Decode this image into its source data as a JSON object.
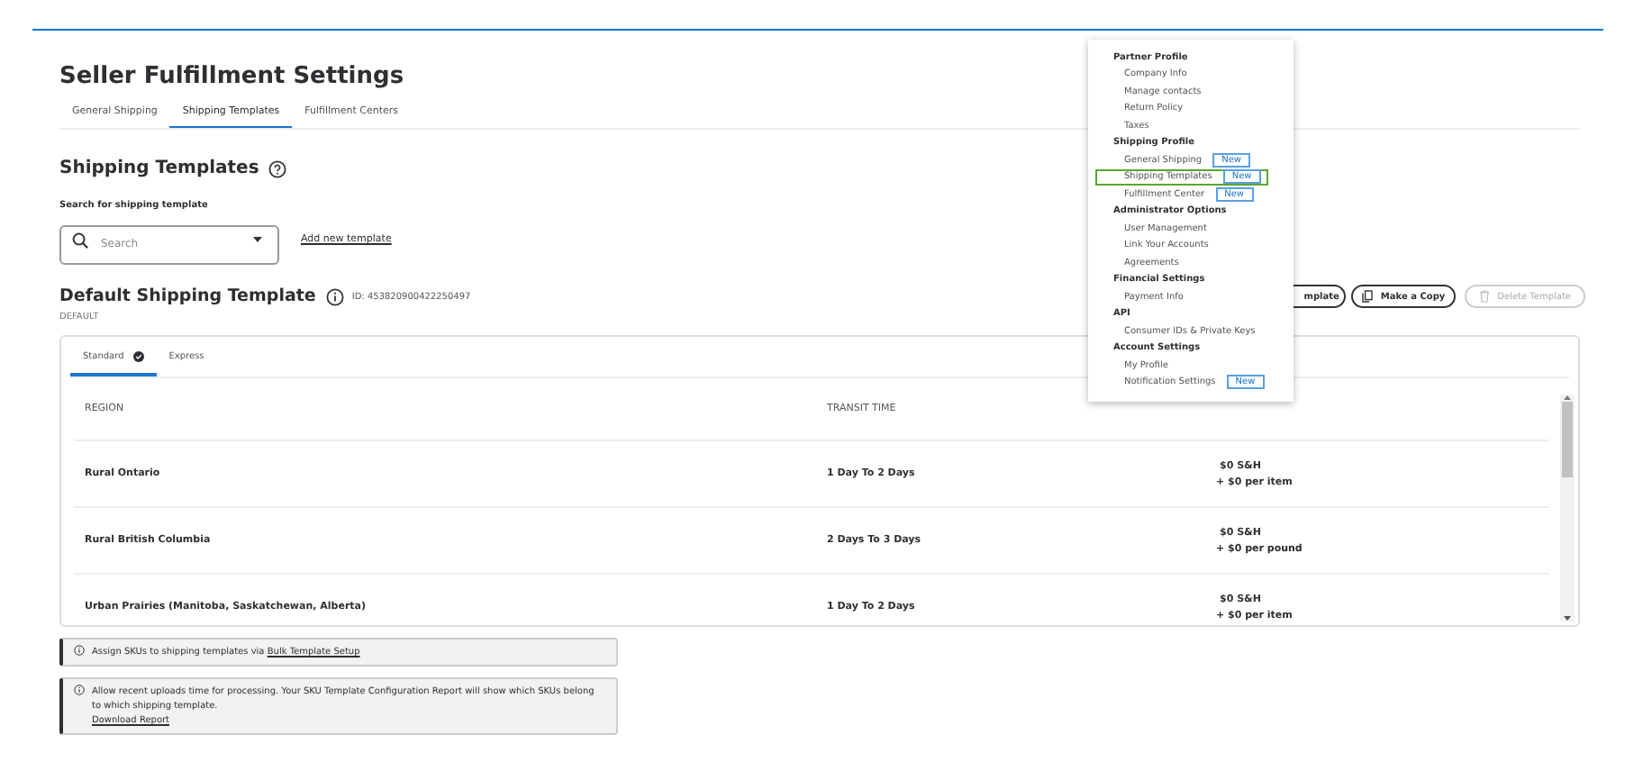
{
  "page": {
    "title": "Seller Fulfillment Settings"
  },
  "tabs": [
    {
      "label": "General Shipping",
      "selected": false
    },
    {
      "label": "Shipping Templates",
      "selected": true
    },
    {
      "label": "Fulfillment Centers",
      "selected": false
    }
  ],
  "section": {
    "title": "Shipping Templates"
  },
  "search": {
    "label": "Search for shipping template",
    "placeholder": "Search"
  },
  "add_link": "Add new template",
  "template": {
    "title": "Default Shipping Template",
    "id": "ID: 453820900422250497",
    "tag": "DEFAULT"
  },
  "actions": [
    {
      "kind": "plain",
      "label": "mplate",
      "disabled": false
    },
    {
      "kind": "copy",
      "label": "Make a Copy",
      "disabled": false
    },
    {
      "kind": "delete",
      "label": "Delete Template",
      "disabled": true
    }
  ],
  "method_tabs": [
    {
      "label": "Standard",
      "selected": true,
      "checked": true
    },
    {
      "label": "Express",
      "selected": false,
      "checked": false
    }
  ],
  "table": {
    "columns": [
      "REGION",
      "TRANSIT TIME"
    ],
    "rows": [
      {
        "region": "Rural Ontario",
        "transit": "1 Day  To  2 Days",
        "rate": "$0 S&H",
        "rate_extra": "+ $0 per item"
      },
      {
        "region": "Rural British Columbia",
        "transit": "2 Days  To  3 Days",
        "rate": "$0 S&H",
        "rate_extra": "+ $0 per pound"
      },
      {
        "region": "Urban Prairies (Manitoba, Saskatchewan, Alberta)",
        "transit": "1 Day  To  2 Days",
        "rate": "$0 S&H",
        "rate_extra": "+ $0 per item"
      }
    ]
  },
  "notices": [
    {
      "text": "Assign SKUs to shipping templates via ",
      "link": "Bulk Template Setup",
      "link_inline": true
    },
    {
      "text": "Allow recent uploads time for processing. Your SKU Template Configuration Report will show which SKUs belong to which shipping template.",
      "link": "Download Report",
      "link_inline": false
    }
  ],
  "menu": {
    "groups": [
      {
        "title": "Partner Profile",
        "items": [
          {
            "label": "Company Info",
            "highlighted": false
          },
          {
            "label": "Manage contacts",
            "highlighted": false
          },
          {
            "label": "Return Policy",
            "highlighted": false
          },
          {
            "label": "Taxes",
            "highlighted": false
          }
        ]
      },
      {
        "title": "Shipping Profile",
        "items": [
          {
            "label": "General Shipping",
            "badge": "New",
            "highlighted": false
          },
          {
            "label": "Shipping Templates",
            "badge": "New",
            "highlighted": true
          },
          {
            "label": "Fulfillment Center",
            "badge": "New",
            "highlighted": false
          }
        ]
      },
      {
        "title": "Administrator Options",
        "items": [
          {
            "label": "User Management",
            "highlighted": false
          },
          {
            "label": "Link Your Accounts",
            "highlighted": false
          },
          {
            "label": "Agreements",
            "highlighted": false
          }
        ]
      },
      {
        "title": "Financial Settings",
        "items": [
          {
            "label": "Payment Info",
            "highlighted": false
          }
        ]
      },
      {
        "title": "API",
        "items": [
          {
            "label": "Consumer IDs & Private Keys",
            "highlighted": false
          }
        ]
      },
      {
        "title": "Account Settings",
        "items": [
          {
            "label": "My Profile",
            "highlighted": false
          },
          {
            "label": "Notification Settings",
            "badge": "New",
            "highlighted": false
          }
        ]
      }
    ]
  }
}
